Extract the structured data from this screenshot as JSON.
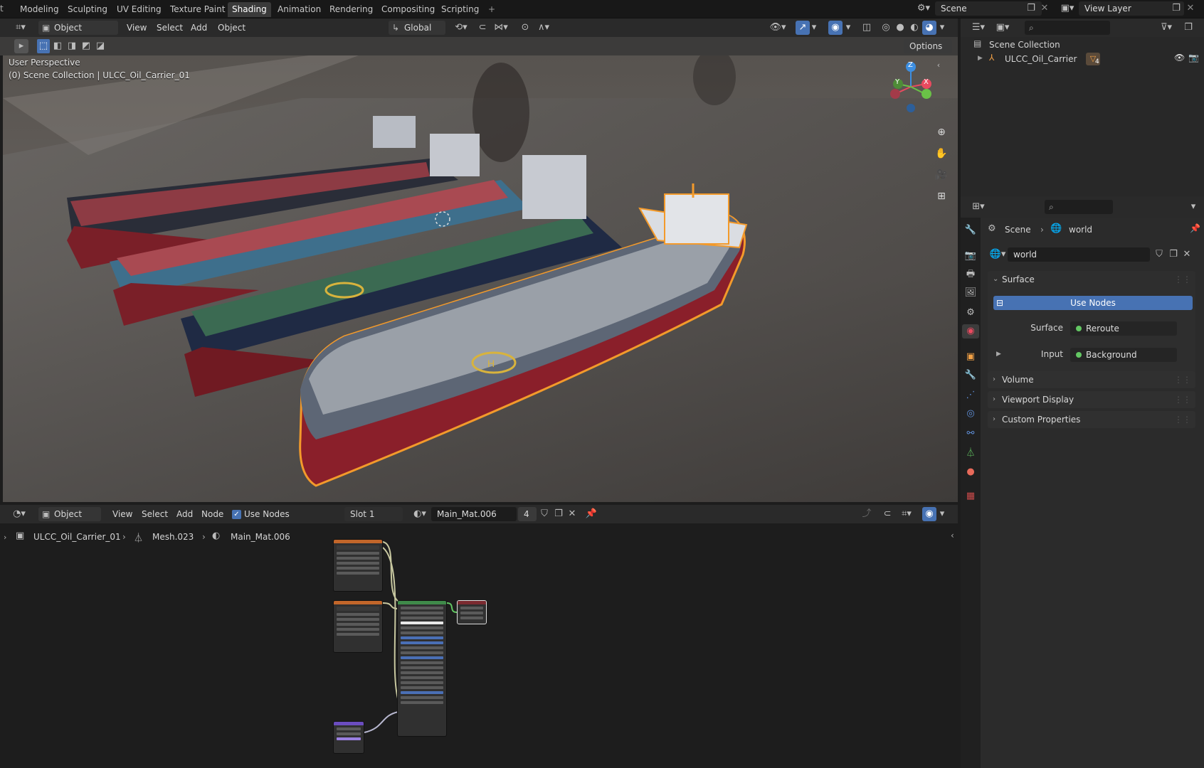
{
  "workspaces": {
    "tabs": [
      "Modeling",
      "Sculpting",
      "UV Editing",
      "Texture Paint",
      "Shading",
      "Animation",
      "Rendering",
      "Compositing",
      "Scripting"
    ],
    "active": "Shading",
    "add_label": "+",
    "scene_label": "Scene",
    "view_layer_label": "View Layer"
  },
  "viewport": {
    "mode": "Object Mode",
    "menus": [
      "View",
      "Select",
      "Add",
      "Object"
    ],
    "transform_orientation": "Global",
    "options_label": "Options",
    "perspective": "User Perspective",
    "collection_info": "(0) Scene Collection | ULCC_Oil_Carrier_01",
    "gizmo_axes": {
      "x": "X",
      "y": "Y",
      "z": "Z"
    }
  },
  "node_editor": {
    "type": "Object",
    "menus": [
      "View",
      "Select",
      "Add",
      "Node"
    ],
    "use_nodes_label": "Use Nodes",
    "use_nodes_checked": true,
    "slot": "Slot 1",
    "material": "Main_Mat.006",
    "users": "4",
    "breadcrumb": [
      "ULCC_Oil_Carrier_01",
      "Mesh.023",
      "Main_Mat.006"
    ]
  },
  "outliner": {
    "root": "Scene Collection",
    "item": "ULCC_Oil_Carrier",
    "item_badge": "4"
  },
  "properties": {
    "breadcrumb": [
      "Scene",
      "world"
    ],
    "world_name": "world",
    "surface_panel": "Surface",
    "use_nodes_button": "Use Nodes",
    "surface_label": "Surface",
    "surface_value": "Reroute",
    "input_label": "Input",
    "input_value": "Background",
    "collapsed_panels": [
      "Volume",
      "Viewport Display",
      "Custom Properties"
    ]
  },
  "colors": {
    "selection_outline": "#f39a2b",
    "active_button": "#4772b3",
    "socket_green": "#63c763",
    "axis_x": "#e84a5f",
    "axis_y": "#6ac147",
    "axis_z": "#3d8ee0"
  }
}
